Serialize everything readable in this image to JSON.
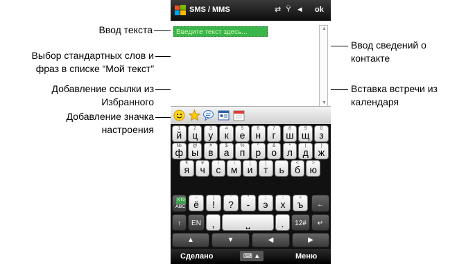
{
  "annotations": {
    "text_input": "Ввод текста",
    "my_text_line1": "Выбор стандартных слов и",
    "my_text_line2": "фраз в списке “Мой текст”",
    "favorites_line1": "Добавление ссылки из",
    "favorites_line2": "Избранного",
    "mood_line1": "Добавление значка",
    "mood_line2": "настроения",
    "contact_line1": "Ввод сведений о",
    "contact_line2": "контакте",
    "calendar_line1": "Вставка встречи из",
    "calendar_line2": "календаря"
  },
  "phone": {
    "title": "SMS / MMS",
    "ok_label": "ok",
    "input_placeholder": "Введите текст здесь...",
    "done_label": "Сделано",
    "menu_label": "Меню",
    "toolbar_icons": [
      "smiley-icon",
      "star-icon",
      "speech-bubble-icon",
      "contact-card-icon",
      "calendar-icon"
    ]
  },
  "keyboard": {
    "row1": [
      {
        "main": "й",
        "hint": "1"
      },
      {
        "main": "ц",
        "hint": "2"
      },
      {
        "main": "у",
        "hint": "3"
      },
      {
        "main": "к",
        "hint": "4"
      },
      {
        "main": "е",
        "hint": "5"
      },
      {
        "main": "н",
        "hint": "6"
      },
      {
        "main": "г",
        "hint": "7"
      },
      {
        "main": "ш",
        "hint": "8"
      },
      {
        "main": "щ",
        "hint": "9"
      },
      {
        "main": "з",
        "hint": "0"
      }
    ],
    "row2": [
      {
        "main": "ф",
        "hint": "№"
      },
      {
        "main": "ы",
        "hint": "@"
      },
      {
        "main": "в",
        "hint": "#"
      },
      {
        "main": "а",
        "hint": "$"
      },
      {
        "main": "п",
        "hint": "%"
      },
      {
        "main": "р",
        "hint": "^"
      },
      {
        "main": "о",
        "hint": "&"
      },
      {
        "main": "л",
        "hint": "*"
      },
      {
        "main": "д",
        "hint": "("
      },
      {
        "main": "ж",
        "hint": ")"
      }
    ],
    "row3": [
      {
        "main": "я",
        "hint": "€"
      },
      {
        "main": "ч",
        "hint": "¥"
      },
      {
        "main": "с",
        "hint": "/"
      },
      {
        "main": "м",
        "hint": "\\"
      },
      {
        "main": "и",
        "hint": "["
      },
      {
        "main": "т",
        "hint": "]"
      },
      {
        "main": "ь",
        "hint": ""
      },
      {
        "main": "б",
        "hint": "<"
      },
      {
        "main": "ю",
        "hint": ">"
      }
    ],
    "row4": [
      {
        "main": "ё",
        "hint": "~"
      },
      {
        "main": "!",
        "hint": "|"
      },
      {
        "main": "?",
        "hint": "'"
      },
      {
        "main": "-",
        "hint": "\""
      },
      {
        "main": "э",
        "hint": ";"
      },
      {
        "main": "х",
        "hint": ":"
      },
      {
        "main": "ъ",
        "hint": "+"
      }
    ],
    "xt9_label": "XT9",
    "abc_label": "ABC",
    "en_label": "EN",
    "num_label": "12#",
    "space_symbol": "⎵",
    "comma": ",",
    "period": "."
  }
}
